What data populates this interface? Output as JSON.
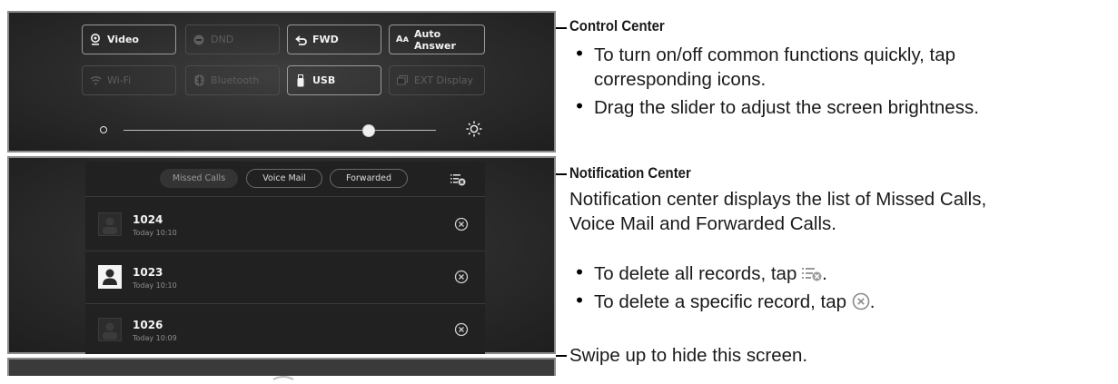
{
  "control_center": {
    "buttons": [
      {
        "label": "Video",
        "icon": "video-icon",
        "state": "on"
      },
      {
        "label": "DND",
        "icon": "dnd-icon",
        "state": "off"
      },
      {
        "label": "FWD",
        "icon": "forward-icon",
        "state": "on"
      },
      {
        "label": "Auto Answer",
        "icon": "auto-answer-icon",
        "state": "on"
      },
      {
        "label": "Wi-Fi",
        "icon": "wifi-icon",
        "state": "off"
      },
      {
        "label": "Bluetooth",
        "icon": "bluetooth-icon",
        "state": "off"
      },
      {
        "label": "USB",
        "icon": "usb-icon",
        "state": "on"
      },
      {
        "label": "EXT Display",
        "icon": "ext-display-icon",
        "state": "off"
      }
    ],
    "brightness_level": 0.77,
    "auto_answer_glyph": "Aᴀ"
  },
  "notification_center": {
    "tabs": [
      "Missed Calls",
      "Voice Mail",
      "Forwarded"
    ],
    "selected_tab": "Missed Calls",
    "records": [
      {
        "number": "1024",
        "time": "Today 10:10"
      },
      {
        "number": "1023",
        "time": "Today 10:10"
      },
      {
        "number": "1026",
        "time": "Today 10:09"
      }
    ]
  },
  "annotations": {
    "control_title": "Control Center",
    "control_b1_l1": "To turn on/off common functions quickly, tap",
    "control_b1_l2": "corresponding icons.",
    "control_b2": "Drag the slider to adjust the screen brightness.",
    "notif_title": "Notification Center",
    "notif_desc_l1": "Notification center displays the list of Missed Calls,",
    "notif_desc_l2": "Voice Mail and Forwarded Calls.",
    "notif_b1": "To delete all records, tap",
    "notif_b2": "To delete a specific record, tap",
    "swipe": "Swipe up to hide this screen."
  },
  "colors": {
    "panel_bg": "#2b2b2b",
    "accent_text": "#f2f2f2",
    "disabled_text": "#5e5e5e"
  }
}
